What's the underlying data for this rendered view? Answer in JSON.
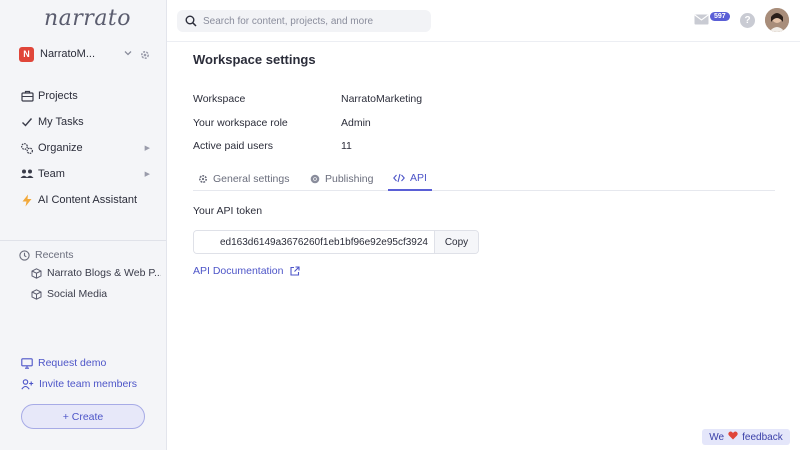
{
  "app": {
    "logo_text": "narrato"
  },
  "workspace": {
    "badge": "N",
    "name": "NarratoM..."
  },
  "sidebar": {
    "items": [
      {
        "label": "Projects",
        "icon": "briefcase-icon"
      },
      {
        "label": "My Tasks",
        "icon": "check-icon"
      },
      {
        "label": "Organize",
        "icon": "cogs-icon"
      },
      {
        "label": "Team",
        "icon": "team-icon"
      },
      {
        "label": "AI Content Assistant",
        "icon": "bolt-icon"
      }
    ],
    "recents_title": "Recents",
    "recents": [
      {
        "label": "Narrato Blogs & Web P...",
        "icon": "cube-icon"
      },
      {
        "label": "Social Media",
        "icon": "cube-icon"
      }
    ],
    "request_demo": "Request demo",
    "invite": "Invite team members",
    "create": "+ Create"
  },
  "topbar": {
    "search_placeholder": "Search for content, projects, and more",
    "mail_count": "597",
    "help": "?"
  },
  "main": {
    "title": "Workspace settings",
    "info": [
      {
        "key": "Workspace",
        "value": "NarratoMarketing"
      },
      {
        "key": "Your workspace role",
        "value": "Admin"
      },
      {
        "key": "Active paid users",
        "value": "11"
      }
    ],
    "tabs": [
      {
        "label": "General settings",
        "icon": "gear-icon"
      },
      {
        "label": "Publishing",
        "icon": "chrome-icon"
      },
      {
        "label": "API",
        "icon": "code-icon",
        "active": true
      }
    ],
    "token_label": "Your API token",
    "token_value": "ed163d6149a3676260f1eb1bf96e92e95cf3924",
    "copy_label": "Copy",
    "api_doc_label": "API Documentation"
  },
  "feedback": {
    "prefix": "We",
    "suffix": "feedback",
    "heart_color": "#e0463a"
  },
  "colors": {
    "accent": "#4d55c8",
    "sidebar_bg": "#f4f5f8",
    "badge_red": "#e0463a"
  }
}
